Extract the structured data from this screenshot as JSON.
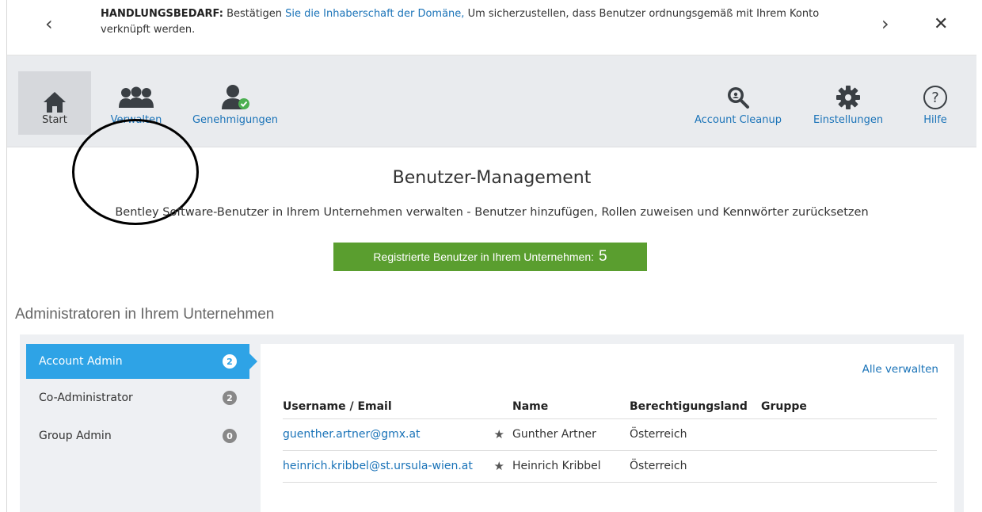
{
  "notification": {
    "heading": "HANDLUNGSBEDARF:",
    "text_before": "Bestätigen",
    "link": "Sie die Inhaberschaft der Domäne,",
    "text_after": "Um sicherzustellen, dass Benutzer ordnungsgemäß mit Ihrem Konto verknüpft werden.",
    "prev_glyph": "‹",
    "next_glyph": "›",
    "close_glyph": "✕"
  },
  "toolbar": {
    "start": "Start",
    "manage": "Verwalten",
    "approvals": "Genehmigungen",
    "account_cleanup": "Account Cleanup",
    "settings": "Einstellungen",
    "help": "Hilfe",
    "icons": [
      "home-icon",
      "users-group-icon",
      "user-check-icon",
      "search-users-icon",
      "gear-icon",
      "question-icon"
    ]
  },
  "main": {
    "title": "Benutzer-Management",
    "subtitle": "Bentley Software-Benutzer in Ihrem Unternehmen verwalten - Benutzer hinzufügen, Rollen zuweisen und Kennwörter zurücksetzen",
    "registered_label": "Registrierte Benutzer in Ihrem Unternehmen:",
    "registered_count": "5"
  },
  "admins": {
    "heading": "Administratoren in Ihrem Unternehmen",
    "roles": [
      {
        "label": "Account Admin",
        "count": "2"
      },
      {
        "label": "Co-Administrator",
        "count": "2"
      },
      {
        "label": "Group Admin",
        "count": "0"
      }
    ],
    "manage_all": "Alle verwalten",
    "columns": [
      "Username / Email",
      "Name",
      "Berechtigungsland",
      "Gruppe"
    ],
    "rows": [
      {
        "email": "guenther.artner@gmx.at",
        "star": "★",
        "name": "Gunther Artner",
        "country": "Österreich",
        "group": ""
      },
      {
        "email": "heinrich.kribbel@st.ursula-wien.at",
        "star": "★",
        "name": "Heinrich Kribbel",
        "country": "Österreich",
        "group": ""
      }
    ]
  },
  "colors": {
    "accent": "#2ea3e6",
    "link": "#1a73b8",
    "success": "#5a9e2f"
  }
}
